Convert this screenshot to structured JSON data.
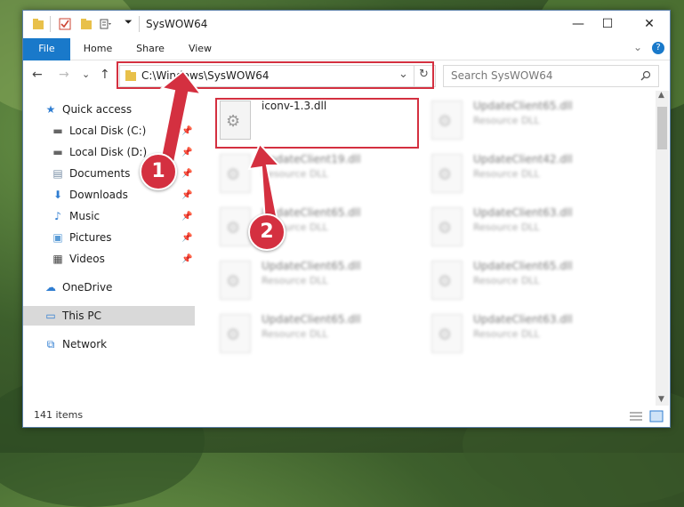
{
  "window": {
    "title": "SysWOW64",
    "minimize": "—",
    "maximize": "☐",
    "close": "✕"
  },
  "ribbon": {
    "tabs": [
      "File",
      "Home",
      "Share",
      "View"
    ],
    "collapse": "⌄",
    "help": "?"
  },
  "nav": {
    "back": "←",
    "forward": "→",
    "recent": "⌄",
    "up": "↑",
    "address": "C:\\Windows\\SysWOW64",
    "dropdown": "⌄",
    "refresh": "↻",
    "search_placeholder": "Search SysWOW64"
  },
  "sidebar": {
    "items": [
      {
        "label": "Quick access",
        "icon": "star-icon"
      },
      {
        "label": "Local Disk (C:)",
        "icon": "drive-icon"
      },
      {
        "label": "Local Disk (D:)",
        "icon": "drive-icon"
      },
      {
        "label": "Documents",
        "icon": "documents-icon"
      },
      {
        "label": "Downloads",
        "icon": "download-icon"
      },
      {
        "label": "Music",
        "icon": "music-icon"
      },
      {
        "label": "Pictures",
        "icon": "pictures-icon"
      },
      {
        "label": "Videos",
        "icon": "videos-icon"
      },
      {
        "label": "OneDrive",
        "icon": "cloud-icon"
      },
      {
        "label": "This PC",
        "icon": "computer-icon"
      },
      {
        "label": "Network",
        "icon": "network-icon"
      }
    ]
  },
  "files": [
    {
      "name": "iconv-1.3.dll",
      "type": ""
    },
    {
      "name": "UpdateClient65.dll",
      "type": "Resource DLL"
    },
    {
      "name": "UpdateClient19.dll",
      "type": "Resource DLL"
    },
    {
      "name": "UpdateClient42.dll",
      "type": "Resource DLL"
    },
    {
      "name": "UpdateClient65.dll",
      "type": "Resource DLL"
    },
    {
      "name": "UpdateClient63.dll",
      "type": "Resource DLL"
    },
    {
      "name": "UpdateClient65.dll",
      "type": "Resource DLL"
    },
    {
      "name": "UpdateClient65.dll",
      "type": "Resource DLL"
    },
    {
      "name": "UpdateClient65.dll",
      "type": "Resource DLL"
    },
    {
      "name": "UpdateClient63.dll",
      "type": "Resource DLL"
    }
  ],
  "status": {
    "count": "141 items"
  },
  "annotations": {
    "step1": "1",
    "step2": "2"
  },
  "colors": {
    "accent": "#1979ca",
    "highlight": "#d43040",
    "selected": "#d9d9d9"
  }
}
